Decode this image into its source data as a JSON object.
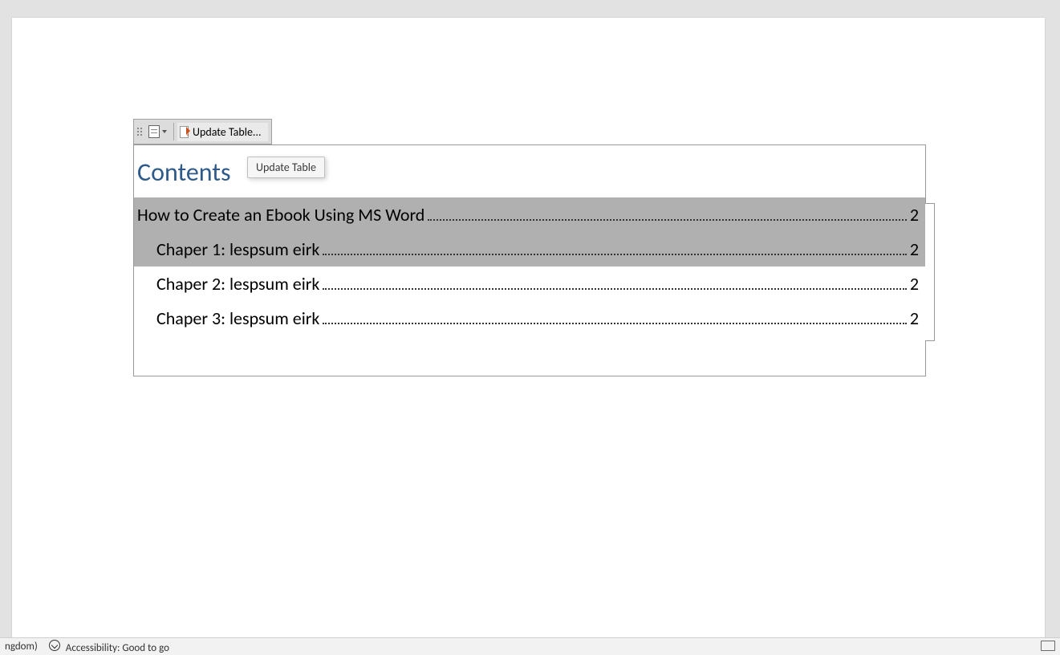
{
  "toolbar": {
    "update_table_label": "Update Table..."
  },
  "tooltip": {
    "text": "Update Table"
  },
  "toc": {
    "title": "Contents",
    "entries": [
      {
        "text": "How to Create an Ebook Using MS Word",
        "page": "2",
        "level": 1,
        "selected": true
      },
      {
        "text": "Chaper 1: lespsum eirk",
        "page": "2",
        "level": 2,
        "selected": true
      },
      {
        "text": "Chaper 2: lespsum eirk",
        "page": "2",
        "level": 2,
        "selected": false
      },
      {
        "text": "Chaper 3: lespsum eirk",
        "page": "2",
        "level": 2,
        "selected": false
      }
    ]
  },
  "statusbar": {
    "language_fragment": "ngdom)",
    "accessibility": "Accessibility: Good to go"
  }
}
